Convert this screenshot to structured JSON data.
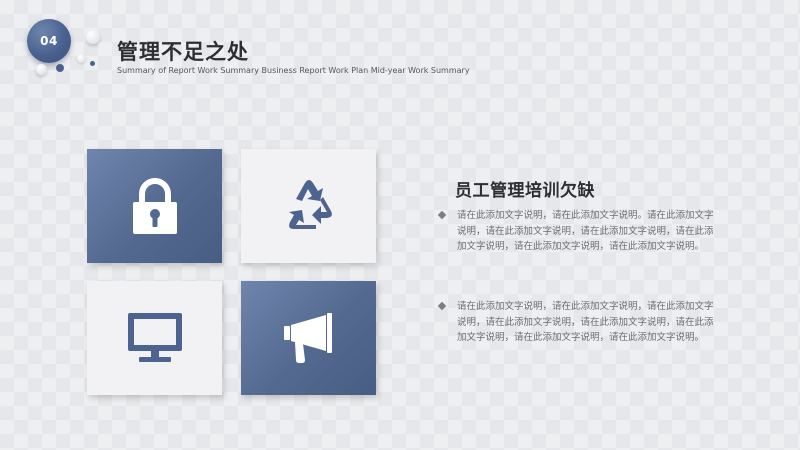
{
  "header": {
    "badge": "04",
    "title": "管理不足之处",
    "subtitle": "Summary of Report Work Summary Business Report Work Plan Mid-year Work Summary"
  },
  "tiles": [
    {
      "icon": "lock-icon",
      "style": "dark"
    },
    {
      "icon": "recycle-icon",
      "style": "light"
    },
    {
      "icon": "monitor-icon",
      "style": "light"
    },
    {
      "icon": "megaphone-icon",
      "style": "dark"
    }
  ],
  "content": {
    "heading": "员工管理培训欠缺",
    "bullets": [
      "请在此添加文字说明，请在此添加文字说明。请在此添加文字说明，请在此添加文字说明，请在此添加文字说明，请在此添加文字说明，请在此添加文字说明，请在此添加文字说明。",
      "请在此添加文字说明，请在此添加文字说明，请在此添加文字说明，请在此添加文字说明，请在此添加文字说明，请在此添加文字说明，请在此添加文字说明，请在此添加文字说明。"
    ]
  },
  "colors": {
    "accent": "#4a6190",
    "tile_dark": "#53698f",
    "tile_light": "#f2f2f4",
    "icon_dark": "#4e6490",
    "heading": "#2f2f33",
    "body_text": "#6a6d73"
  }
}
